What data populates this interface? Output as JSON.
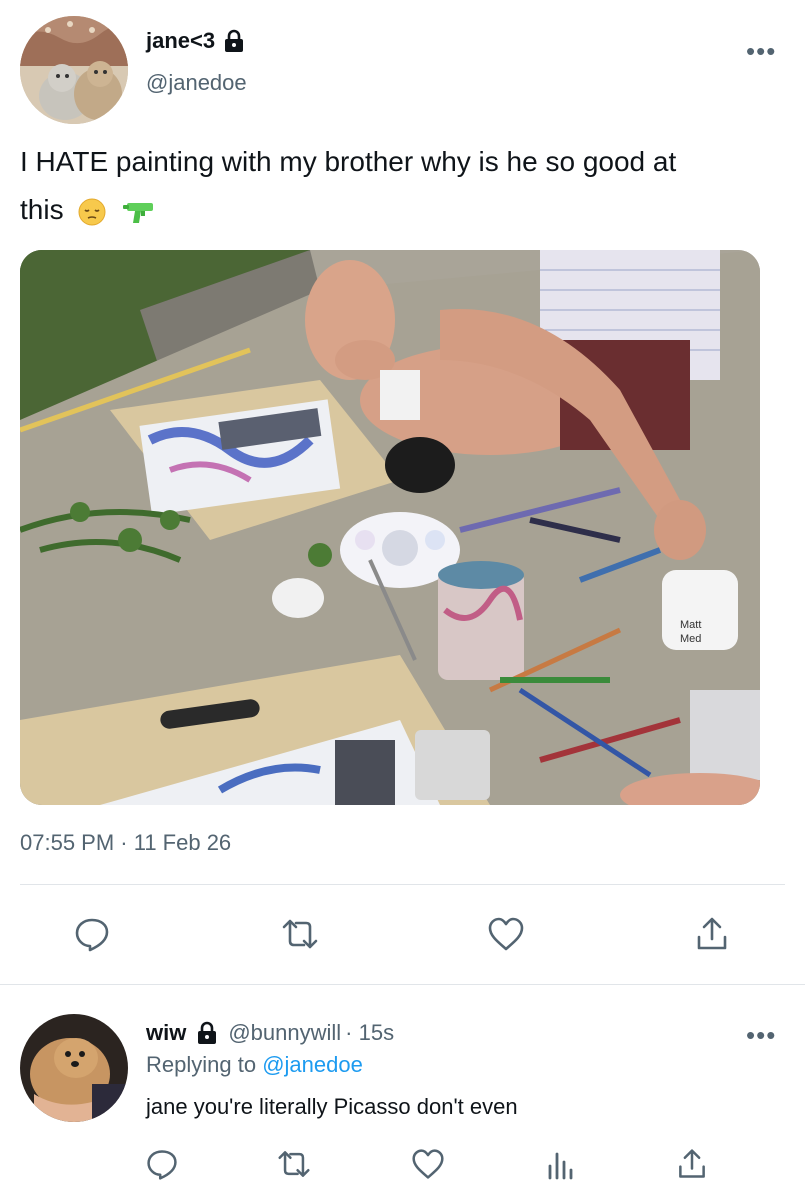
{
  "tweet": {
    "display_name": "jane<3",
    "handle": "@janedoe",
    "text_line1": "I HATE painting with my brother why is he so good at",
    "text_line2": "this",
    "emojis": [
      "pensive-face",
      "water-pistol"
    ],
    "timestamp": "07:55 PM · 11 Feb 26",
    "more_label": "•••"
  },
  "reply": {
    "display_name": "wiw",
    "handle": "@bunnywill",
    "time": "· 15s",
    "replying_prefix": "Replying to",
    "replying_to": "@janedoe",
    "text": "jane you're literally Picasso don't even",
    "more_label": "•••"
  },
  "icons": {
    "tweet_actions": [
      "reply-icon",
      "retweet-icon",
      "like-icon",
      "share-icon"
    ],
    "reply_actions": [
      "reply-icon",
      "retweet-icon",
      "like-icon",
      "analytics-icon",
      "share-icon"
    ]
  },
  "colors": {
    "text": "#0f1419",
    "secondary": "#536471",
    "link": "#1d9bf0",
    "divider": "#e1e5e9"
  }
}
